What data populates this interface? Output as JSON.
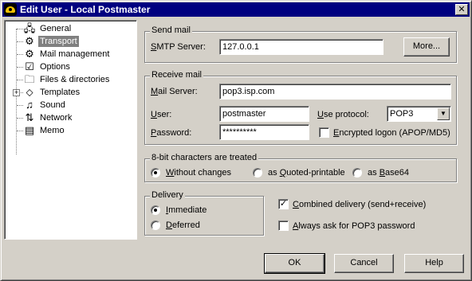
{
  "window": {
    "title": "Edit User - Local Postmaster",
    "close": "✕"
  },
  "tree": {
    "items": [
      {
        "label": "General",
        "icon": "🖧",
        "icon_name": "general-icon"
      },
      {
        "label": "Transport",
        "icon": "⚙",
        "icon_name": "gears-icon",
        "selected": true
      },
      {
        "label": "Mail management",
        "icon": "⚙",
        "icon_name": "mail-management-icon"
      },
      {
        "label": "Options",
        "icon": "☑",
        "icon_name": "options-icon"
      },
      {
        "label": "Files & directories",
        "icon": "🗀",
        "icon_name": "folder-icon"
      },
      {
        "label": "Templates",
        "icon": "⬦",
        "icon_name": "templates-icon",
        "expander": "+"
      },
      {
        "label": "Sound",
        "icon": "♫",
        "icon_name": "sound-icon"
      },
      {
        "label": "Network",
        "icon": "⇅",
        "icon_name": "network-icon"
      },
      {
        "label": "Memo",
        "icon": "▤",
        "icon_name": "memo-icon"
      }
    ]
  },
  "send_mail": {
    "title": "Send mail",
    "smtp_label_pre": "",
    "smtp_label_u": "S",
    "smtp_label_post": "MTP Server:",
    "smtp_value": "127.0.0.1",
    "more_button": "More..."
  },
  "receive_mail": {
    "title": "Receive mail",
    "server_label_u": "M",
    "server_label_post": "ail Server:",
    "server_value": "pop3.isp.com",
    "user_label_u": "U",
    "user_label_post": "ser:",
    "user_value": "postmaster",
    "protocol_label_u": "U",
    "protocol_label_post": "se protocol:",
    "protocol_value": "POP3",
    "password_label_u": "P",
    "password_label_post": "assword:",
    "password_value": "**********",
    "encrypted_label_u": "E",
    "encrypted_label_post": "ncrypted logon (APOP/MD5)",
    "encrypted_checked": false
  },
  "eightbit": {
    "title": "8-bit characters are treated",
    "opt1_u": "W",
    "opt1_post": "ithout changes",
    "opt2_pre": "as ",
    "opt2_u": "Q",
    "opt2_post": "uoted-printable",
    "opt3_pre": "as ",
    "opt3_u": "B",
    "opt3_post": "ase64",
    "selected": "Without changes"
  },
  "delivery": {
    "title": "Delivery",
    "opt1_u": "I",
    "opt1_post": "mmediate",
    "opt2_u": "D",
    "opt2_post": "eferred",
    "selected": "Immediate"
  },
  "options": {
    "combined_u": "C",
    "combined_post": "ombined delivery (send+receive)",
    "combined_checked": true,
    "always_u": "A",
    "always_post": "lways ask for POP3 password",
    "always_checked": false
  },
  "buttons": {
    "ok": "OK",
    "cancel": "Cancel",
    "help": "Help"
  }
}
